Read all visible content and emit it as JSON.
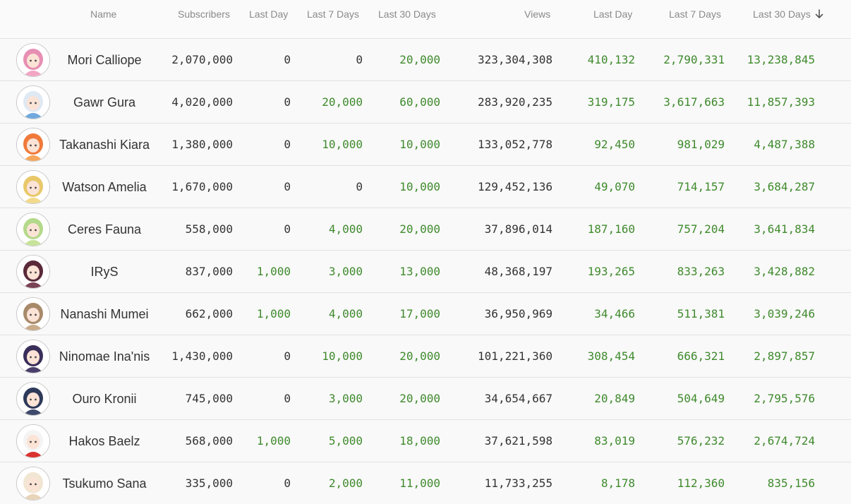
{
  "columns": {
    "name": "Name",
    "subscribers": "Subscribers",
    "subs_last_day": "Last Day",
    "subs_last_7": "Last 7 Days",
    "subs_last_30": "Last 30 Days",
    "views": "Views",
    "views_last_day": "Last Day",
    "views_last_7": "Last 7 Days",
    "views_last_30": "Last 30 Days",
    "sort_icon": "arrow-down-icon"
  },
  "colors": {
    "text": "#333333",
    "header_text": "#8a8a8a",
    "positive": "#3f8a2d",
    "border": "#e2e2e2"
  },
  "rows": [
    {
      "name": "Mori Calliope",
      "subscribers": "2,070,000",
      "subs_last_day": "0",
      "subs_last_7": "0",
      "subs_last_30": "20,000",
      "views": "323,304,308",
      "views_last_day": "410,132",
      "views_last_7": "2,790,331",
      "views_last_30": "13,238,845",
      "avatar_color": "#f2a6c4",
      "avatar_hair": "#e78fb3"
    },
    {
      "name": "Gawr Gura",
      "subscribers": "4,020,000",
      "subs_last_day": "0",
      "subs_last_7": "20,000",
      "subs_last_30": "60,000",
      "views": "283,920,235",
      "views_last_day": "319,175",
      "views_last_7": "3,617,663",
      "views_last_30": "11,857,393",
      "avatar_color": "#6fa8dc",
      "avatar_hair": "#dfe9f3"
    },
    {
      "name": "Takanashi Kiara",
      "subscribers": "1,380,000",
      "subs_last_day": "0",
      "subs_last_7": "10,000",
      "subs_last_30": "10,000",
      "views": "133,052,778",
      "views_last_day": "92,450",
      "views_last_7": "981,029",
      "views_last_30": "4,487,388",
      "avatar_color": "#f6a55a",
      "avatar_hair": "#f07a3a"
    },
    {
      "name": "Watson Amelia",
      "subscribers": "1,670,000",
      "subs_last_day": "0",
      "subs_last_7": "0",
      "subs_last_30": "10,000",
      "views": "129,452,136",
      "views_last_day": "49,070",
      "views_last_7": "714,157",
      "views_last_30": "3,684,287",
      "avatar_color": "#f3d98a",
      "avatar_hair": "#e9c86a"
    },
    {
      "name": "Ceres Fauna",
      "subscribers": "558,000",
      "subs_last_day": "0",
      "subs_last_7": "4,000",
      "subs_last_30": "20,000",
      "views": "37,896,014",
      "views_last_day": "187,160",
      "views_last_7": "757,204",
      "views_last_30": "3,641,834",
      "avatar_color": "#c7e39a",
      "avatar_hair": "#b3d98a"
    },
    {
      "name": "IRyS",
      "subscribers": "837,000",
      "subs_last_day": "1,000",
      "subs_last_7": "3,000",
      "subs_last_30": "13,000",
      "views": "48,368,197",
      "views_last_day": "193,265",
      "views_last_7": "833,263",
      "views_last_30": "3,428,882",
      "avatar_color": "#7a4255",
      "avatar_hair": "#5a2a3a"
    },
    {
      "name": "Nanashi Mumei",
      "subscribers": "662,000",
      "subs_last_day": "1,000",
      "subs_last_7": "4,000",
      "subs_last_30": "17,000",
      "views": "36,950,969",
      "views_last_day": "34,466",
      "views_last_7": "511,381",
      "views_last_30": "3,039,246",
      "avatar_color": "#c9ab8a",
      "avatar_hair": "#a88a6a"
    },
    {
      "name": "Ninomae Ina'nis",
      "subscribers": "1,430,000",
      "subs_last_day": "0",
      "subs_last_7": "10,000",
      "subs_last_30": "20,000",
      "views": "101,221,360",
      "views_last_day": "308,454",
      "views_last_7": "666,321",
      "views_last_30": "2,897,857",
      "avatar_color": "#4a3f6b",
      "avatar_hair": "#3a2f5a"
    },
    {
      "name": "Ouro Kronii",
      "subscribers": "745,000",
      "subs_last_day": "0",
      "subs_last_7": "3,000",
      "subs_last_30": "20,000",
      "views": "34,654,667",
      "views_last_day": "20,849",
      "views_last_7": "504,649",
      "views_last_30": "2,795,576",
      "avatar_color": "#3e4a6b",
      "avatar_hair": "#2e3a5a"
    },
    {
      "name": "Hakos Baelz",
      "subscribers": "568,000",
      "subs_last_day": "1,000",
      "subs_last_7": "5,000",
      "subs_last_30": "18,000",
      "views": "37,621,598",
      "views_last_day": "83,019",
      "views_last_7": "576,232",
      "views_last_30": "2,674,724",
      "avatar_color": "#d9322f",
      "avatar_hair": "#f4f4f4"
    },
    {
      "name": "Tsukumo Sana",
      "subscribers": "335,000",
      "subs_last_day": "0",
      "subs_last_7": "2,000",
      "subs_last_30": "11,000",
      "views": "11,733,255",
      "views_last_day": "8,178",
      "views_last_7": "112,360",
      "views_last_30": "835,156",
      "avatar_color": "#e8d4b8",
      "avatar_hair": "#f1e6d3"
    }
  ]
}
